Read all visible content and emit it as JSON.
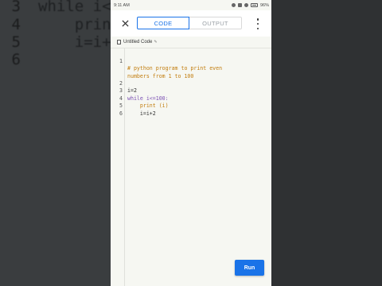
{
  "background_code": [
    {
      "num": "3",
      "text": "while i<"
    },
    {
      "num": "4",
      "text": "    prin"
    },
    {
      "num": "5",
      "text": "    i=i+"
    },
    {
      "num": "6",
      "text": ""
    }
  ],
  "status_bar": {
    "time": "9:11 AM",
    "battery": "96%"
  },
  "tabs": [
    {
      "label": "CODE",
      "active": true
    },
    {
      "label": "OUTPUT",
      "active": false
    }
  ],
  "file": {
    "name": "Untitled Code"
  },
  "code": [
    {
      "num": "1",
      "text": "# python program to print even",
      "kind": "comment"
    },
    {
      "num": "",
      "text": "numbers from 1 to 100",
      "kind": "comment"
    },
    {
      "num": "",
      "text": "",
      "kind": "plain"
    },
    {
      "num": "2",
      "text": "i=2",
      "kind": "plain"
    },
    {
      "num": "3",
      "text": "while i<=100:",
      "kind": "mixed"
    },
    {
      "num": "4",
      "text": "    print (i)",
      "kind": "mixed2"
    },
    {
      "num": "5",
      "text": "    i=i+2",
      "kind": "plain"
    },
    {
      "num": "6",
      "text": "",
      "kind": "plain"
    }
  ],
  "run_label": "Run",
  "colors": {
    "accent": "#1a73e8",
    "comment": "#c27d0e",
    "keyword": "#7a4fb3"
  },
  "icons": {
    "close": "close-icon",
    "more": "more-vert-icon",
    "file": "file-icon",
    "edit": "edit-icon"
  }
}
